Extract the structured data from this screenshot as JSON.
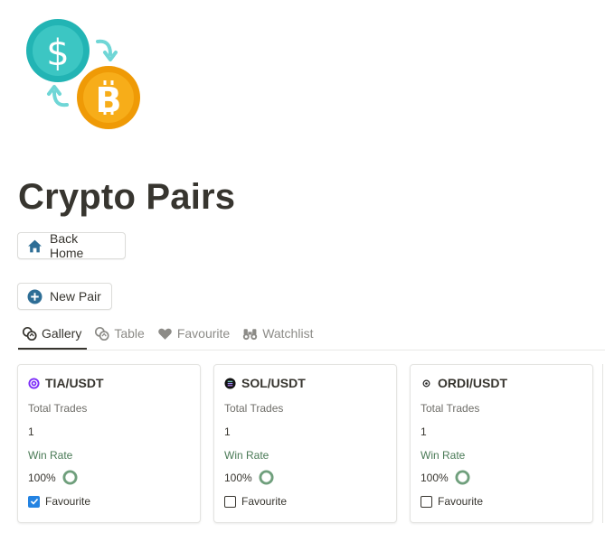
{
  "page": {
    "title": "Crypto Pairs",
    "icon": "usd-to-bitcoin-exchange-icon"
  },
  "buttons": {
    "back_home": {
      "label": "Back Home",
      "icon": "home-icon"
    },
    "new_pair": {
      "label": "New Pair",
      "icon": "plus-circle-icon"
    }
  },
  "tabs": [
    {
      "label": "Gallery",
      "icon": "gallery-icon",
      "active": true
    },
    {
      "label": "Table",
      "icon": "table-icon",
      "active": false
    },
    {
      "label": "Favourite",
      "icon": "heart-icon",
      "active": false
    },
    {
      "label": "Watchlist",
      "icon": "binoculars-icon",
      "active": false
    }
  ],
  "card_labels": {
    "total_trades": "Total Trades",
    "win_rate": "Win Rate",
    "favourite": "Favourite"
  },
  "cards": [
    {
      "name": "TIA/USDT",
      "icon": "celestia-icon",
      "total_trades": "1",
      "win_rate": "100%",
      "win_rate_value": 1.0,
      "favourite": true
    },
    {
      "name": "SOL/USDT",
      "icon": "solana-icon",
      "total_trades": "1",
      "win_rate": "100%",
      "win_rate_value": 1.0,
      "favourite": false
    },
    {
      "name": "ORDI/USDT",
      "icon": "ordi-icon",
      "total_trades": "1",
      "win_rate": "100%",
      "win_rate_value": 1.0,
      "favourite": false
    }
  ],
  "colors": {
    "dollar_coin": "#2bb8b8",
    "bitcoin_coin": "#f5a30c",
    "win_ring": "#6f9f7c",
    "checkbox_checked": "#2383e2",
    "button_icon": "#2e6e96"
  }
}
